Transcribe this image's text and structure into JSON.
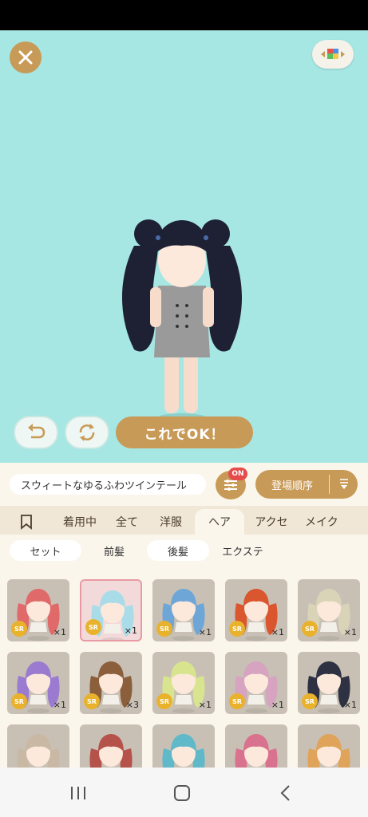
{
  "stage": {
    "bg_color": "#a6e6e3",
    "close_icon": "close-icon",
    "bg_switch_icon": "color-blocks-icon",
    "undo_icon": "undo-icon",
    "rotate_icon": "rotate-icon",
    "ok_label": "これでOK！"
  },
  "namebar": {
    "item_name": "スウィートなゆるふわツインテール",
    "filter_badge": "ON",
    "sort_label": "登場順序"
  },
  "tabs": [
    {
      "label": ""
    },
    {
      "label": "着用中"
    },
    {
      "label": "全て"
    },
    {
      "label": "洋服"
    },
    {
      "label": "ヘア"
    },
    {
      "label": "アクセ"
    },
    {
      "label": "メイク"
    }
  ],
  "subtabs": [
    {
      "label": "セット"
    },
    {
      "label": "前髪"
    },
    {
      "label": "後髪"
    },
    {
      "label": "エクステ"
    }
  ],
  "items": [
    {
      "rarity": "SR",
      "count": "×1",
      "hair": "#e06a6a"
    },
    {
      "rarity": "SR",
      "count": "×1",
      "hair": "#a9dce8"
    },
    {
      "rarity": "SR",
      "count": "×1",
      "hair": "#6fa6d8"
    },
    {
      "rarity": "SR",
      "count": "×1",
      "hair": "#d9562e"
    },
    {
      "rarity": "SR",
      "count": "×1",
      "hair": "#d9d3b8"
    },
    {
      "rarity": "SR",
      "count": "×1",
      "hair": "#9a7bd0"
    },
    {
      "rarity": "SR",
      "count": "×3",
      "hair": "#8b5e3c"
    },
    {
      "rarity": "SR",
      "count": "×1",
      "hair": "#d8e48e"
    },
    {
      "rarity": "SR",
      "count": "×1",
      "hair": "#d6a3c0"
    },
    {
      "rarity": "SR",
      "count": "×1",
      "hair": "#2e3142"
    },
    {
      "rarity": "",
      "count": "",
      "hair": "#c9b8a4"
    },
    {
      "rarity": "",
      "count": "",
      "hair": "#b5524a"
    },
    {
      "rarity": "",
      "count": "",
      "hair": "#5fb9c9"
    },
    {
      "rarity": "",
      "count": "",
      "hair": "#d9728e"
    },
    {
      "rarity": "",
      "count": "",
      "hair": "#e0a35a"
    }
  ],
  "navbar": {
    "recents_icon": "recents-icon",
    "home_icon": "home-icon",
    "back_icon": "back-icon"
  }
}
